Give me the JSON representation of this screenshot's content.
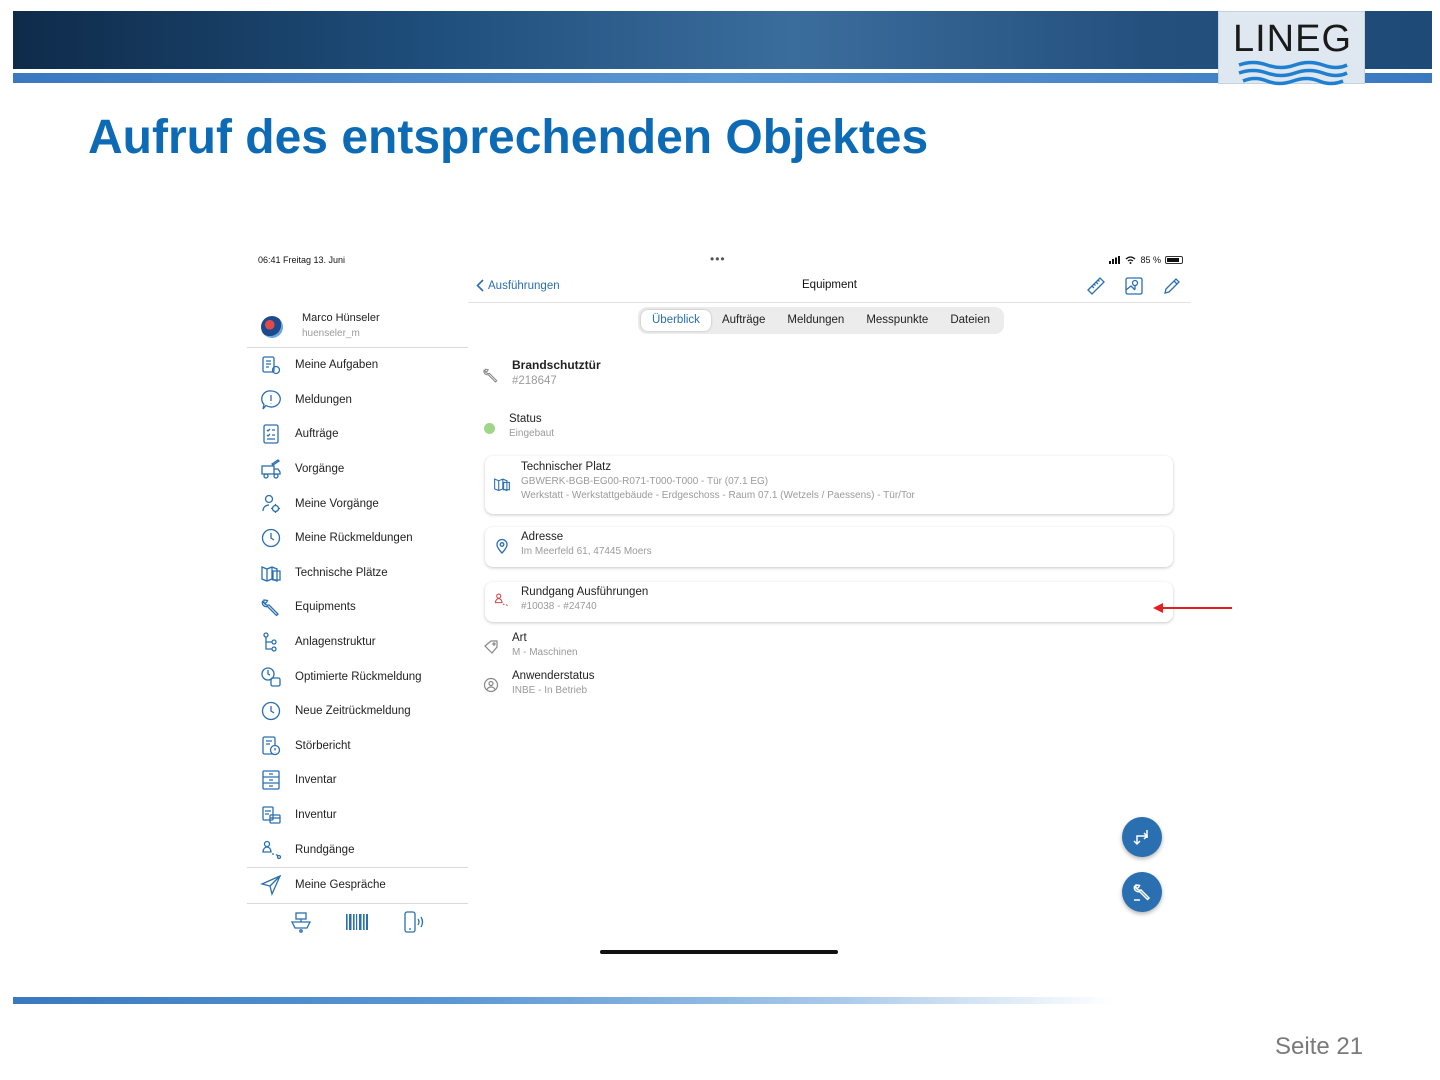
{
  "slide": {
    "title": "Aufruf des entsprechenden Objektes",
    "logo_text": "LINEG",
    "page_label": "Seite 21",
    "brand_color": "#0d6bb5"
  },
  "statusbar": {
    "time": "06:41  Freitag 13. Juni",
    "dots": "•••",
    "battery": "85 %"
  },
  "sidebar": {
    "user_name": "Marco Hünseler",
    "user_login": "huenseler_m",
    "items": [
      {
        "label": "Meine Aufgaben",
        "icon": "tasks-icon"
      },
      {
        "label": "Meldungen",
        "icon": "speech-alert-icon"
      },
      {
        "label": "Aufträge",
        "icon": "checklist-icon"
      },
      {
        "label": "Vorgänge",
        "icon": "truck-edit-icon"
      },
      {
        "label": "Meine Vorgänge",
        "icon": "user-gear-icon"
      },
      {
        "label": "Meine Rückmeldungen",
        "icon": "clock-icon"
      },
      {
        "label": "Technische Plätze",
        "icon": "map-building-icon"
      },
      {
        "label": "Equipments",
        "icon": "wrench-icon"
      },
      {
        "label": "Anlagenstruktur",
        "icon": "hierarchy-icon"
      },
      {
        "label": "Optimierte Rückmeldung",
        "icon": "optimized-feedback-icon"
      },
      {
        "label": "Neue Zeitrückmeldung",
        "icon": "clock-icon"
      },
      {
        "label": "Störbericht",
        "icon": "report-alert-icon"
      },
      {
        "label": "Inventar",
        "icon": "cabinet-icon"
      },
      {
        "label": "Inventur",
        "icon": "inventory-icon"
      },
      {
        "label": "Rundgänge",
        "icon": "route-icon"
      },
      {
        "label": "Meine Gespräche",
        "icon": "send-icon"
      }
    ],
    "bottom_icons": [
      "ship-icon",
      "barcode-icon",
      "nfc-phone-icon"
    ]
  },
  "topbar": {
    "back_label": "Ausführungen",
    "title": "Equipment",
    "actions": [
      "ruler-icon",
      "map-pin-icon",
      "pencil-icon"
    ]
  },
  "tabs": [
    "Überblick",
    "Aufträge",
    "Meldungen",
    "Messpunkte",
    "Dateien"
  ],
  "active_tab": "Überblick",
  "details": {
    "equipment_name": "Brandschutztür",
    "equipment_id": "#218647",
    "status_label": "Status",
    "status_value": "Eingebaut",
    "status_color": "#9fd68a",
    "tech_place_label": "Technischer Platz",
    "tech_place_code": "GBWERK-BGB-EG00-R071-T000-T000 - Tür (07.1 EG)",
    "tech_place_desc": "Werkstatt - Werkstattgebäude - Erdgeschoss - Raum 07.1 (Wetzels / Paessens) - Tür/Tor",
    "address_label": "Adresse",
    "address_value": "Im Meerfeld 61, 47445 Moers",
    "round_label": "Rundgang Ausführungen",
    "round_value": "#10038 - #24740",
    "art_label": "Art",
    "art_value": "M - Maschinen",
    "user_status_label": "Anwenderstatus",
    "user_status_value": "INBE - In Betrieb"
  },
  "accent_color": "#2a6fb0",
  "annotation_arrow_color": "#e02020"
}
